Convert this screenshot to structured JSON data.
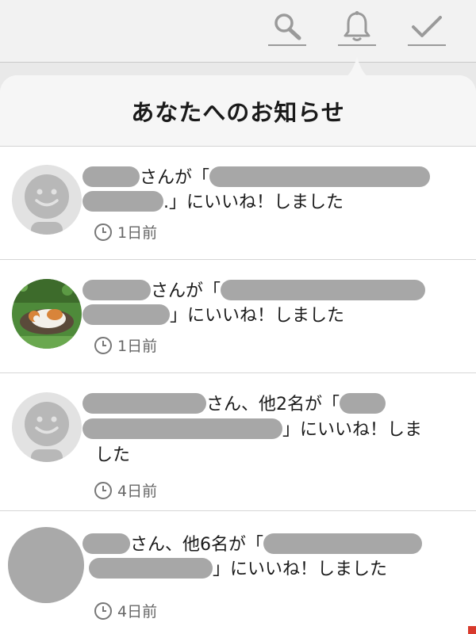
{
  "toolbar": {
    "search_icon": "search-icon",
    "notification_icon": "bell-icon",
    "done_icon": "check-icon"
  },
  "panel": {
    "title": "あなたへのお知らせ"
  },
  "notifications": [
    {
      "avatar": "default-face",
      "segments": [
        "さんが「",
        ".」にいいね！しました"
      ],
      "time": "1日前"
    },
    {
      "avatar": "cat-photo",
      "segments": [
        "さんが「",
        "」にいいね！しました"
      ],
      "time": "1日前"
    },
    {
      "avatar": "default-face",
      "segments": [
        "さん、他2名が「",
        "」にいいね！しま",
        "した"
      ],
      "time": "4日前"
    },
    {
      "avatar": "gray-circle",
      "segments": [
        "さん、他6名が「",
        "」にいいね！しました"
      ],
      "time": "4日前"
    }
  ],
  "colors": {
    "redacted": "#a7a7a7",
    "accent_edge": "#d83a2c"
  }
}
